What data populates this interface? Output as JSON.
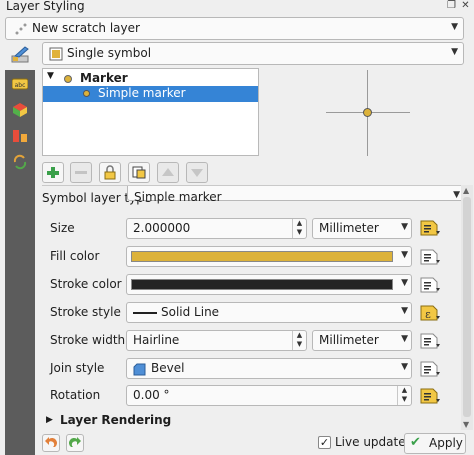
{
  "window": {
    "title": "Layer Styling",
    "float_glyph": "❐",
    "close_glyph": "✕"
  },
  "layer_combo": {
    "value": "New scratch layer"
  },
  "renderer_combo": {
    "value": "Single symbol"
  },
  "symbol_tree": {
    "items": [
      {
        "label": "Marker"
      },
      {
        "label": "Simple marker"
      }
    ]
  },
  "symbol_layer_type": {
    "label": "Symbol layer type",
    "value": "Simple marker"
  },
  "properties": {
    "size": {
      "label": "Size",
      "value": "2.000000",
      "unit": "Millimeter"
    },
    "fill_color": {
      "label": "Fill color",
      "color": "#dcb23a"
    },
    "stroke_color": {
      "label": "Stroke color",
      "color": "#232323"
    },
    "stroke_style": {
      "label": "Stroke style",
      "value": "Solid Line"
    },
    "stroke_width": {
      "label": "Stroke width",
      "value": "Hairline",
      "unit": "Millimeter"
    },
    "join_style": {
      "label": "Join style",
      "value": "Bevel"
    },
    "rotation": {
      "label": "Rotation",
      "value": "0.00 °"
    }
  },
  "layer_rendering": {
    "label": "Layer Rendering"
  },
  "footer": {
    "live_update_label": "Live update",
    "live_update_checked": true,
    "apply_label": "Apply"
  },
  "colors": {
    "accent": "#3584d6",
    "sidebar": "#5c5c5c",
    "marker_fill": "#dcb23a"
  }
}
